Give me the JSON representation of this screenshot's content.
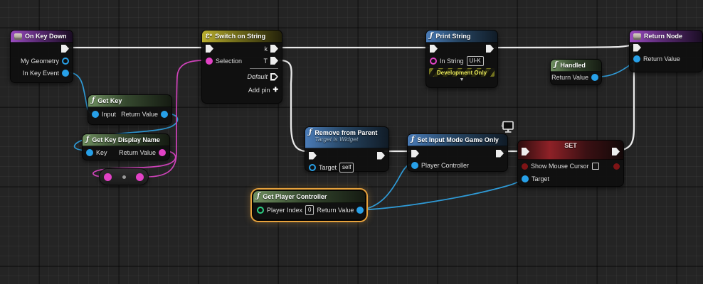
{
  "icons": {
    "function": "ƒ",
    "switch": "Ɛ*",
    "add": "✚",
    "collapse": "▼"
  },
  "colors": {
    "exec_wire": "#e9e9e9",
    "data_blue": "#27a0e8",
    "data_pink": "#e242c6",
    "data_green": "#2ecf84",
    "bool_red": "#7e1416",
    "selection_orange": "#e8a33d",
    "header_event_purple": "#9a4cc0",
    "header_pure_green": "#6f8f60",
    "header_switch_olive": "#b9ae2f",
    "header_function_blue": "#4a7cb8",
    "header_set_red": "#8e2127"
  },
  "nodes": {
    "on_key_down": {
      "title": "On Key Down",
      "pin_my_geometry": "My Geometry",
      "pin_in_key_event": "In Key Event"
    },
    "get_key": {
      "title": "Get Key",
      "pin_input": "Input",
      "pin_return_value": "Return Value"
    },
    "get_key_display_name": {
      "title": "Get Key Display Name",
      "pin_key": "Key",
      "pin_return_value": "Return Value"
    },
    "switch_on_string": {
      "title": "Switch on String",
      "pin_selection": "Selection",
      "pin_case_k": "k",
      "pin_case_t": "T",
      "pin_default": "Default",
      "add_pin_label": "Add pin"
    },
    "remove_from_parent": {
      "title": "Remove from Parent",
      "subtitle": "Target is Widget",
      "pin_target": "Target",
      "target_value": "self"
    },
    "set_input_mode_game_only": {
      "title": "Set Input Mode Game Only",
      "pin_player_controller": "Player Controller"
    },
    "set_show_mouse_cursor": {
      "title": "SET",
      "pin_show_mouse_cursor": "Show Mouse Cursor",
      "pin_target": "Target"
    },
    "get_player_controller": {
      "title": "Get Player Controller",
      "pin_player_index": "Player Index",
      "player_index_value": "0",
      "pin_return_value": "Return Value"
    },
    "print_string": {
      "title": "Print String",
      "pin_in_string": "In String",
      "in_string_value": "UI-K",
      "banner": "Development Only"
    },
    "handled": {
      "title": "Handled",
      "pin_return_value": "Return Value"
    },
    "return_node": {
      "title": "Return Node",
      "pin_return_value": "Return Value"
    }
  }
}
